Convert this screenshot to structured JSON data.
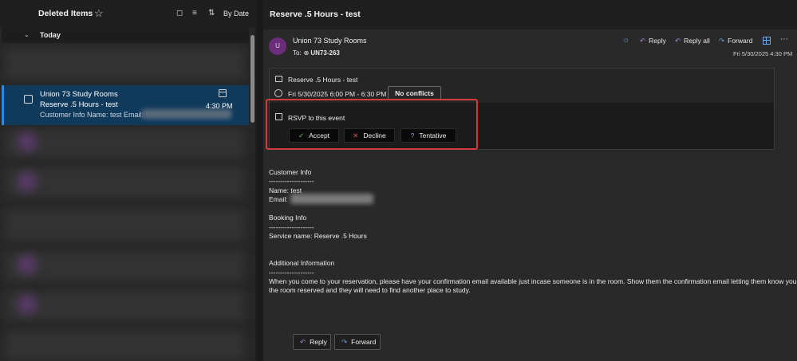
{
  "list": {
    "folder_title": "Deleted Items",
    "sort_label": "By Date",
    "group_label": "Today",
    "selected": {
      "sender": "Union 73 Study Rooms",
      "subject": "Reserve .5 Hours - test",
      "preview": "Customer Info Name: test Email:",
      "time": "4:30 PM"
    }
  },
  "message": {
    "title": "Reserve .5 Hours - test",
    "avatar_initial": "U",
    "sender": "Union 73 Study Rooms",
    "to_label": "To:",
    "to_address": "UN73-263",
    "actions": {
      "reply": "Reply",
      "reply_all": "Reply all",
      "forward": "Forward"
    },
    "date": "Fri 5/30/2025 4:30 PM"
  },
  "event": {
    "subject": "Reserve .5 Hours - test",
    "time": "Fri 5/30/2025 6:00 PM - 6:30 PM",
    "conflicts": "No conflicts",
    "rsvp_label": "RSVP to this event",
    "accept": "Accept",
    "decline": "Decline",
    "tentative": "Tentative"
  },
  "body": {
    "customer_heading": "Customer Info",
    "rule1": "--------------------",
    "name_line": "Name: test",
    "email_label": "Email:",
    "booking_heading": "Booking Info",
    "rule2": "--------------------",
    "service_line": "Service name: Reserve .5 Hours",
    "additional_heading": "Additional Information",
    "rule3": "--------------------",
    "para_line1": "When you come to your reservation, please have your confirmation email available just incase someone is in the room.  Show them the confirmation email letting them know you have",
    "para_line2": "the room reserved and they will need to find another place to study."
  },
  "footer": {
    "reply": "Reply",
    "forward": "Forward"
  },
  "colors": {
    "selected_bg": "#0f3a5c",
    "highlight": "#d63b3b",
    "accent_purple": "#a98ad8",
    "accent_blue": "#6fa6e6"
  }
}
